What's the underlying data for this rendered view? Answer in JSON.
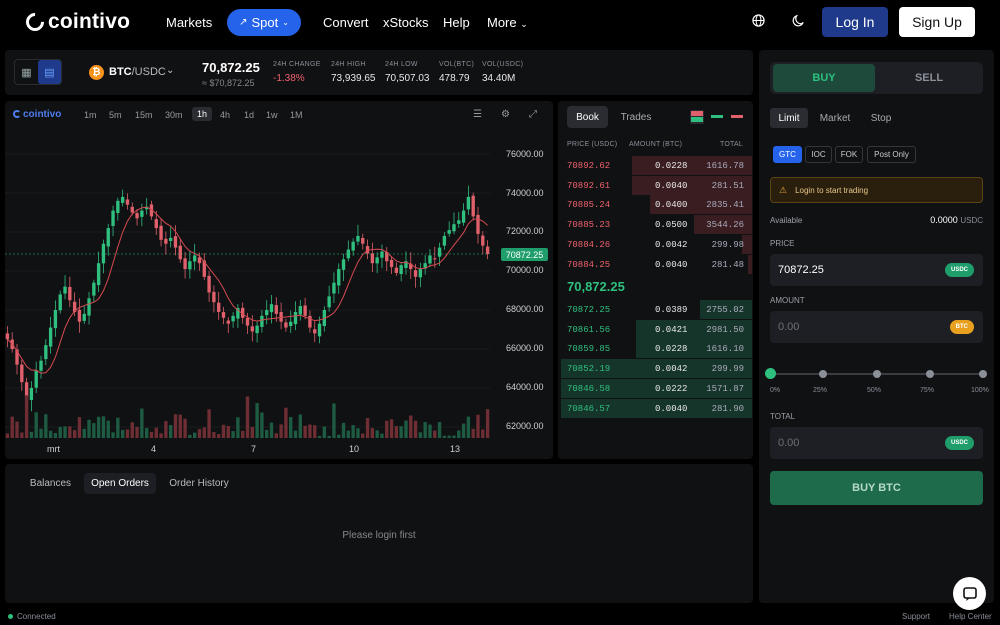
{
  "header": {
    "logo": "cointivo",
    "nav": [
      "Markets",
      "Spot",
      "Convert",
      "xStocks",
      "Help",
      "More"
    ],
    "login": "Log In",
    "signup": "Sign Up",
    "icons": [
      "globe-icon",
      "moon-icon"
    ]
  },
  "ticker": {
    "base": "BTC",
    "quote": "/USDC",
    "last_price": "70,872.25",
    "last_price_fiat": "≈ $70,872.25",
    "stats": [
      {
        "label": "24H CHANGE",
        "value": "-1.38%",
        "color": "#f0616d"
      },
      {
        "label": "24H HIGH",
        "value": "73,939.65",
        "color": "#e8e8e8"
      },
      {
        "label": "24H LOW",
        "value": "70,507.03",
        "color": "#e8e8e8"
      },
      {
        "label": "VOL(BTC)",
        "value": "478.79",
        "color": "#e8e8e8"
      },
      {
        "label": "VOL(USDC)",
        "value": "34.40M",
        "color": "#e8e8e8"
      }
    ]
  },
  "chart": {
    "brand": "cointivo",
    "timeframes": [
      "1m",
      "5m",
      "15m",
      "30m",
      "1h",
      "4h",
      "1d",
      "1w",
      "1M"
    ],
    "active_timeframe": "1h",
    "current_tag": "70872.25",
    "y_labels": [
      "76000.00",
      "74000.00",
      "72000.00",
      "70000.00",
      "68000.00",
      "66000.00",
      "64000.00",
      "62000.00"
    ],
    "x_labels": [
      "mrt",
      "4",
      "7",
      "10",
      "13"
    ]
  },
  "chart_data": {
    "type": "line",
    "series_kind": "candlestick",
    "ylim": [
      61500,
      77000
    ],
    "x_ticks": [
      "mrt",
      "4",
      "7",
      "10",
      "13"
    ],
    "close": [
      66500,
      66000,
      65200,
      64300,
      63500,
      64000,
      64900,
      65400,
      66200,
      67100,
      68000,
      68800,
      69200,
      68500,
      67900,
      67400,
      67800,
      68600,
      69400,
      70400,
      71400,
      72200,
      73100,
      73600,
      73800,
      73400,
      73000,
      72700,
      73100,
      73300,
      72800,
      72200,
      71600,
      71400,
      71700,
      71200,
      70600,
      70100,
      70500,
      70800,
      70400,
      69700,
      68900,
      68400,
      67900,
      67600,
      67300,
      67700,
      68100,
      67600,
      67200,
      66900,
      67200,
      67700,
      68000,
      68300,
      67800,
      67400,
      67100,
      67400,
      67900,
      68200,
      67700,
      67100,
      66800,
      67300,
      68000,
      68700,
      69400,
      70100,
      70600,
      71100,
      71500,
      71800,
      71400,
      70900,
      70400,
      70700,
      71000,
      70500,
      70200,
      69900,
      70300,
      70500,
      70100,
      69700,
      70100,
      70400,
      70800,
      70600,
      71200,
      71800,
      72100,
      72400,
      72600,
      73100,
      73800,
      72800,
      71900,
      71300,
      70872
    ],
    "current": 70872.25
  },
  "orderbook": {
    "tabs": [
      "Book",
      "Trades"
    ],
    "headers": [
      "PRICE (USDC)",
      "AMOUNT (BTC)",
      "TOTAL"
    ],
    "asks": [
      {
        "price": "70892.62",
        "amount": "0.0228",
        "total": "1616.78",
        "depth": 0.62
      },
      {
        "price": "70892.61",
        "amount": "0.0040",
        "total": "281.51",
        "depth": 0.62
      },
      {
        "price": "70885.24",
        "amount": "0.0400",
        "total": "2835.41",
        "depth": 0.53
      },
      {
        "price": "70885.23",
        "amount": "0.0500",
        "total": "3544.26",
        "depth": 0.3
      },
      {
        "price": "70884.26",
        "amount": "0.0042",
        "total": "299.98",
        "depth": 0.05
      },
      {
        "price": "70884.25",
        "amount": "0.0040",
        "total": "281.48",
        "depth": 0.02
      }
    ],
    "mid": "70,872.25",
    "bids": [
      {
        "price": "70872.25",
        "amount": "0.0389",
        "total": "2755.02",
        "depth": 0.27
      },
      {
        "price": "70861.56",
        "amount": "0.0421",
        "total": "2981.50",
        "depth": 0.6
      },
      {
        "price": "70859.85",
        "amount": "0.0228",
        "total": "1616.10",
        "depth": 0.6
      },
      {
        "price": "70852.19",
        "amount": "0.0042",
        "total": "299.99",
        "depth": 0.99
      },
      {
        "price": "70846.58",
        "amount": "0.0222",
        "total": "1571.87",
        "depth": 0.99
      },
      {
        "price": "70846.57",
        "amount": "0.0040",
        "total": "281.90",
        "depth": 0.99
      }
    ]
  },
  "orders": {
    "tabs": [
      "Balances",
      "Open Orders",
      "Order History"
    ],
    "active": "Open Orders",
    "empty": "Please login first"
  },
  "form": {
    "side_tabs": [
      "BUY",
      "SELL"
    ],
    "order_types": [
      "Limit",
      "Market",
      "Stop"
    ],
    "tif": [
      "GTC",
      "IOC",
      "FOK",
      "Post Only"
    ],
    "warning": "Login to start trading",
    "available_label": "Available",
    "available_value": "0.0000",
    "available_ccy": "USDC",
    "price_label": "PRICE",
    "price_value": "70872.25",
    "price_ccy": "USDC",
    "amount_label": "AMOUNT",
    "amount_placeholder": "0.00",
    "amount_ccy": "BTC",
    "slider_marks": [
      "0%",
      "25%",
      "50%",
      "75%",
      "100%"
    ],
    "slider_value": 0,
    "total_label": "TOTAL",
    "total_placeholder": "0.00",
    "total_ccy": "USDC",
    "submit": "BUY BTC"
  },
  "footer": {
    "status": "Connected",
    "links": [
      "Support",
      "Help Center"
    ]
  }
}
